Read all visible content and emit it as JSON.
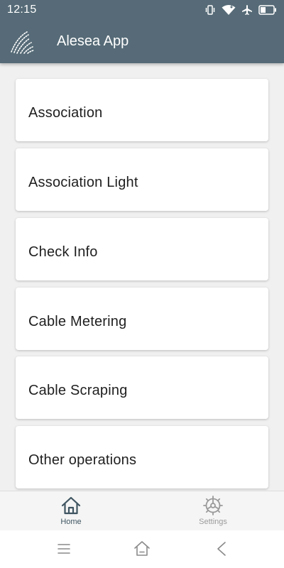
{
  "status_bar": {
    "time": "12:15",
    "icons": [
      "vibrate-icon",
      "wifi-icon",
      "airplane-icon",
      "battery-icon"
    ]
  },
  "app_bar": {
    "title": "Alesea App",
    "logo": "alesea-logo"
  },
  "menu": {
    "items": [
      {
        "label": "Association"
      },
      {
        "label": "Association Light"
      },
      {
        "label": "Check Info"
      },
      {
        "label": "Cable Metering"
      },
      {
        "label": "Cable Scraping"
      },
      {
        "label": "Other operations"
      }
    ]
  },
  "bottom_nav": {
    "active_color": "#3f5561",
    "inactive_color": "#9a9a9a",
    "items": [
      {
        "label": "Home",
        "icon": "home-icon",
        "active": true
      },
      {
        "label": "Settings",
        "icon": "settings-icon",
        "active": false
      }
    ]
  },
  "system_nav": {
    "buttons": [
      "menu-icon",
      "home-icon",
      "back-icon"
    ]
  },
  "colors": {
    "app_bar": "#566b77",
    "background": "#f0f0f0",
    "card": "#ffffff",
    "text": "#1f1f1f"
  }
}
